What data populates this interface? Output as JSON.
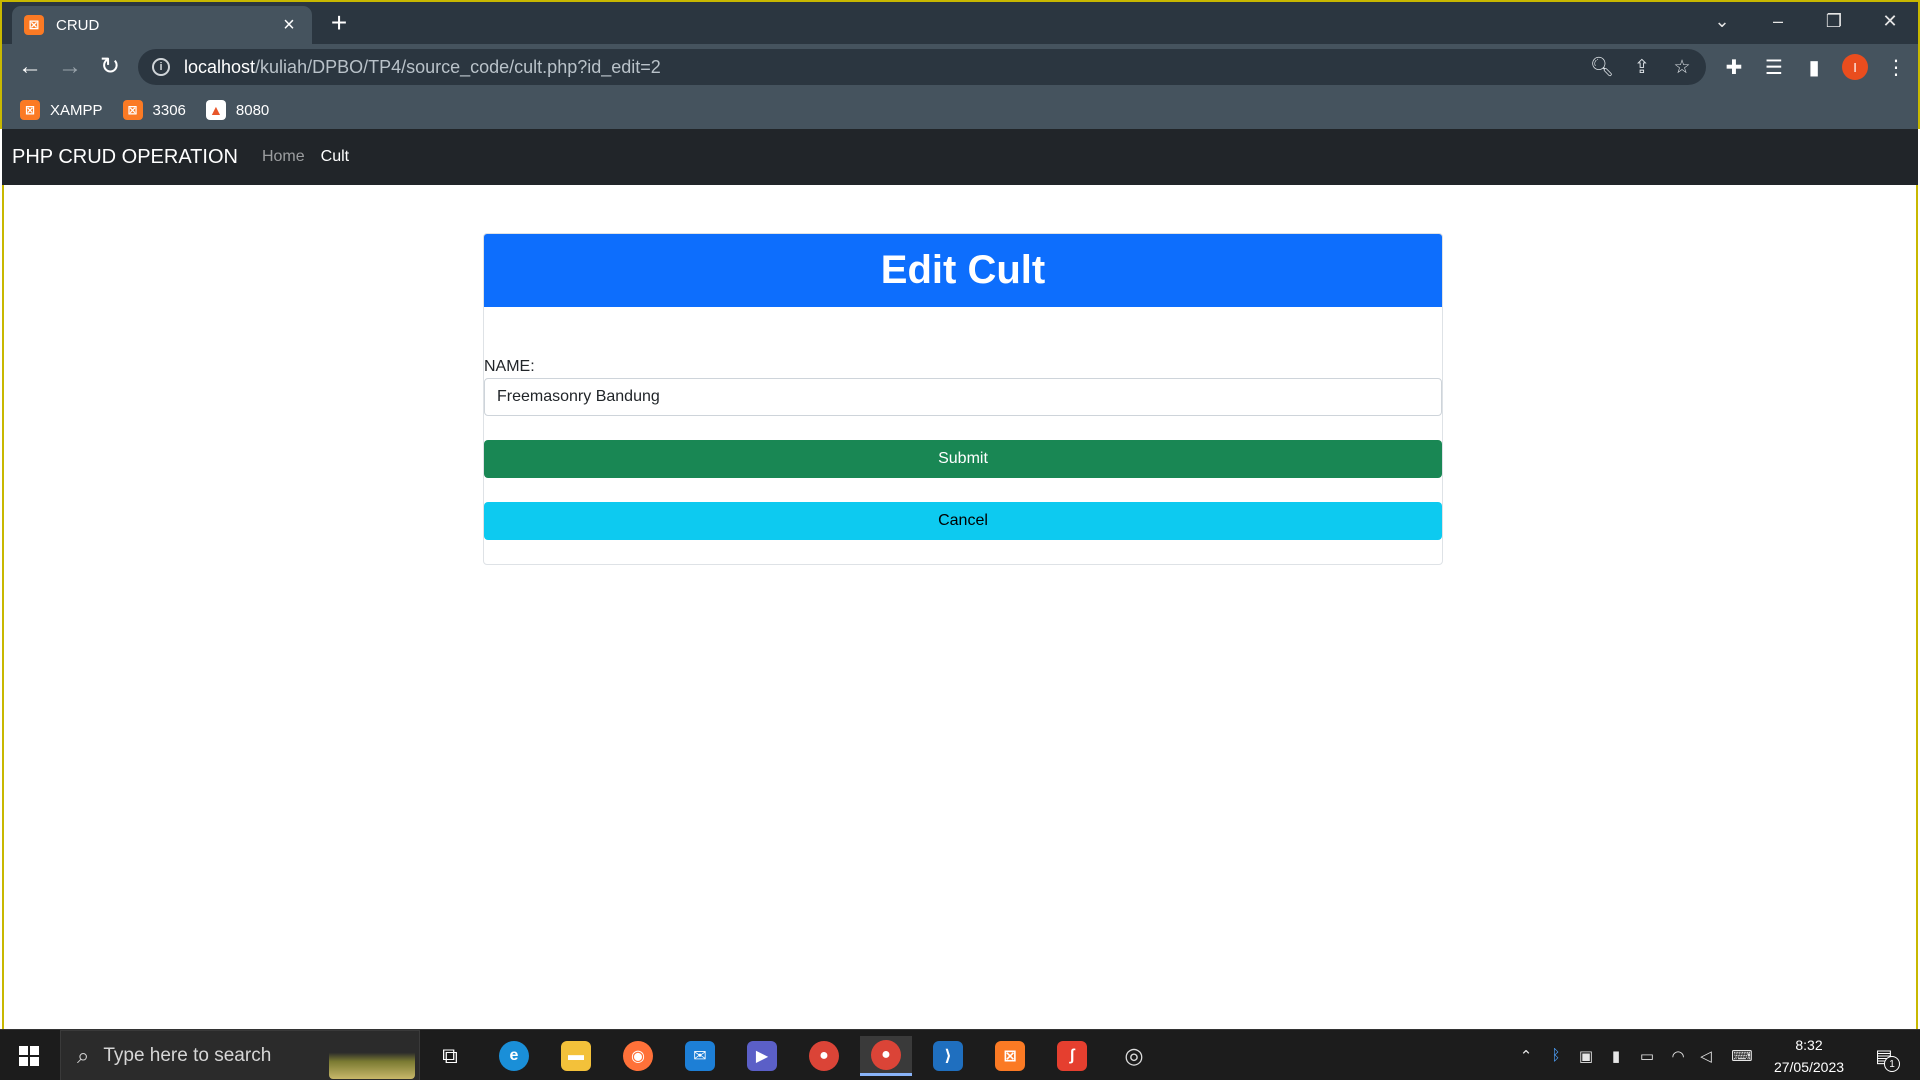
{
  "browser": {
    "tab_title": "CRUD",
    "tab_close": "×",
    "new_tab": "+",
    "url_host": "localhost",
    "url_path": "/kuliah/DPBO/TP4/source_code/cult.php?id_edit=2",
    "profile_initial": "I",
    "bookmarks": [
      "XAMPP",
      "3306",
      "8080"
    ]
  },
  "navbar": {
    "brand": "PHP CRUD OPERATION",
    "links": [
      "Home",
      "Cult"
    ]
  },
  "form": {
    "heading": "Edit Cult",
    "name_label": "NAME:",
    "name_value": "Freemasonry Bandung",
    "submit_label": "Submit",
    "cancel_label": "Cancel"
  },
  "taskbar": {
    "search_placeholder": "Type here to search",
    "time": "8:32",
    "date": "27/05/2023",
    "notification_count": "1"
  },
  "colors": {
    "header_blue": "#0d6efd",
    "submit_green": "#198754",
    "cancel_cyan": "#0dcaf0",
    "navbar_dark": "#212529"
  }
}
